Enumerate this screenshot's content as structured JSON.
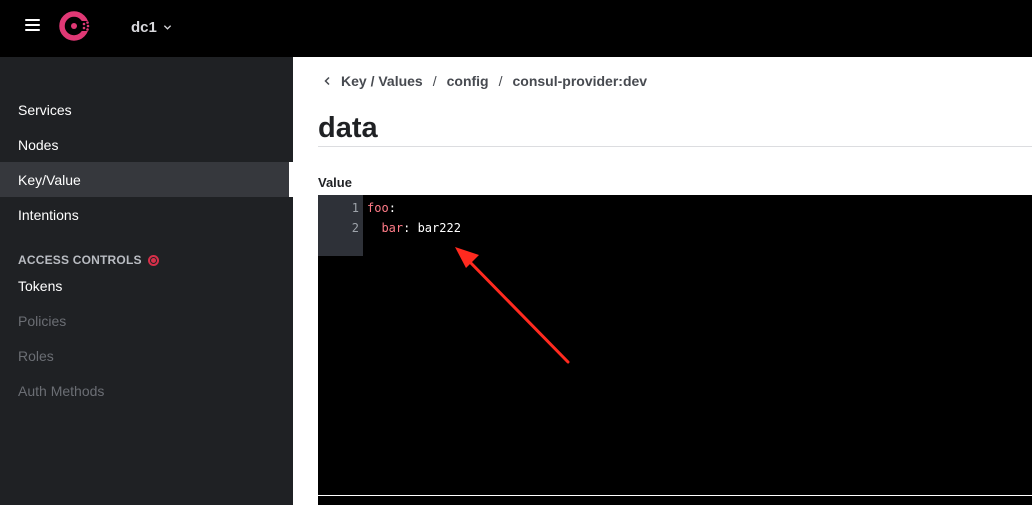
{
  "header": {
    "datacenter": "dc1",
    "icons": {
      "menu": "hamburger-menu-icon",
      "logo": "consul-logo-icon",
      "chevron": "chevron-down-icon"
    }
  },
  "sidebar": {
    "items": [
      {
        "label": "Services",
        "state": "normal"
      },
      {
        "label": "Nodes",
        "state": "normal"
      },
      {
        "label": "Key/Value",
        "state": "active"
      },
      {
        "label": "Intentions",
        "state": "normal"
      }
    ],
    "access_controls": {
      "heading": "ACCESS CONTROLS",
      "items": [
        {
          "label": "Tokens",
          "state": "normal"
        },
        {
          "label": "Policies",
          "state": "disabled"
        },
        {
          "label": "Roles",
          "state": "disabled"
        },
        {
          "label": "Auth Methods",
          "state": "disabled"
        }
      ]
    }
  },
  "main": {
    "breadcrumb": [
      "Key / Values",
      "config",
      "consul-provider:dev"
    ],
    "breadcrumb_separator": "/",
    "title": "data",
    "value_label": "Value",
    "editor": {
      "lines": [
        {
          "number": "1",
          "key": "foo",
          "punct": ":",
          "value": ""
        },
        {
          "number": "2",
          "key": "  bar",
          "punct": ": ",
          "value": "bar222"
        }
      ]
    }
  },
  "colors": {
    "topbar": "#000000",
    "sidebar": "#1f2124",
    "sidebar_active": "#36383d",
    "brand": "#e03875",
    "status_dot": "#d62f49",
    "code_key": "#ff7b87",
    "annotation_arrow": "#ff2a1f"
  }
}
